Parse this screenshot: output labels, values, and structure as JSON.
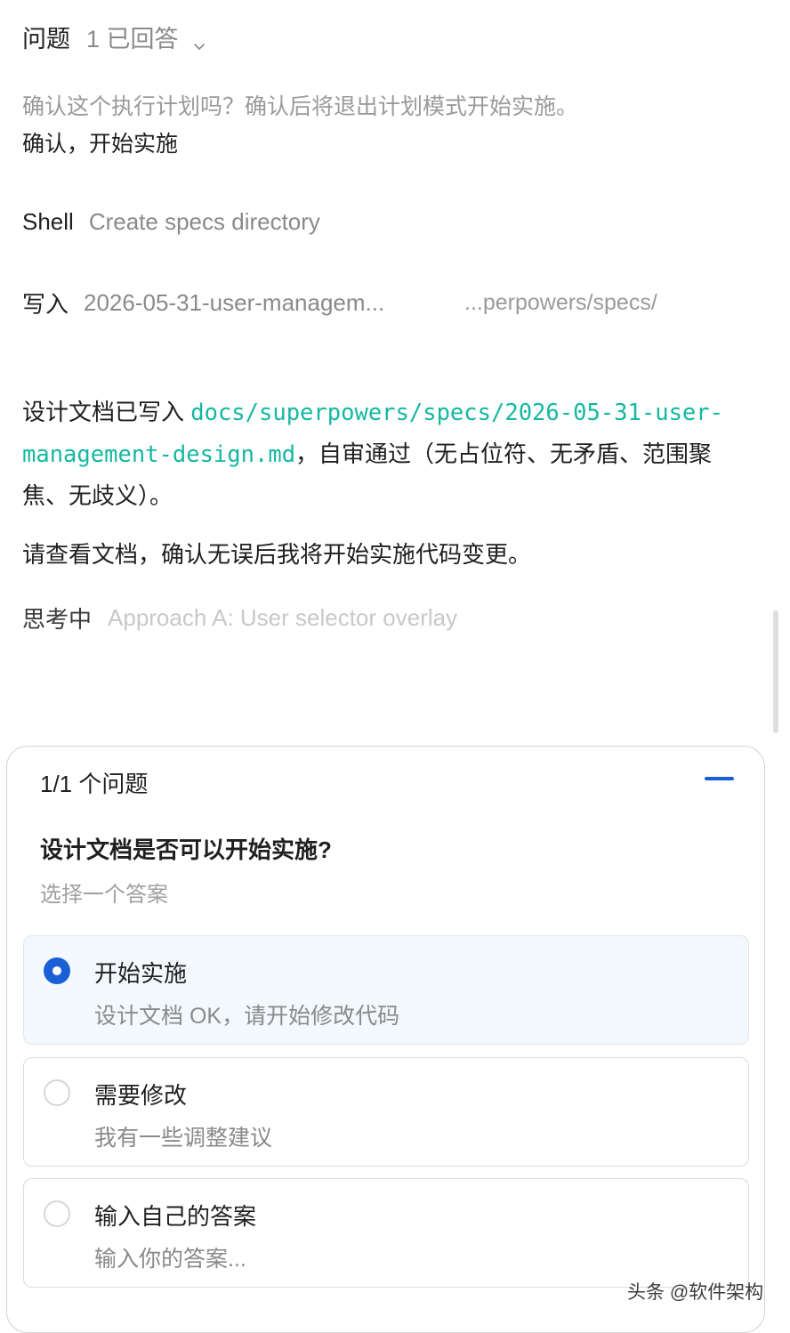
{
  "question_summary": {
    "label": "问题",
    "count": "1 已回答",
    "icon": "chevron-down-icon"
  },
  "prompt": "确认这个执行计划吗？确认后将退出计划模式开始实施。",
  "answer": "确认，开始实施",
  "shell_step": {
    "tool": "Shell",
    "description": "Create specs directory"
  },
  "write_step": {
    "tool": "写入",
    "filename": "2026-05-31-user-managem...",
    "path": "...perpowers/specs/"
  },
  "message": {
    "part1": "设计文档已写入 ",
    "code": "docs/superpowers/specs/2026-05-31-user-management-design.md",
    "part2": "，自审通过（无占位符、无矛盾、范围聚焦、无歧义）。",
    "line2": "请查看文档，确认无误后我将开始实施代码变更。"
  },
  "thinking": {
    "label": "思考中",
    "text": "Approach A: User selector overlay"
  },
  "question_panel": {
    "header": "1/1 个问题",
    "question": "设计文档是否可以开始实施?",
    "hint": "选择一个答案",
    "options": [
      {
        "label": "开始实施",
        "description": "设计文档 OK，请开始修改代码",
        "selected": true
      },
      {
        "label": "需要修改",
        "description": "我有一些调整建议",
        "selected": false
      },
      {
        "label": "输入自己的答案",
        "description": "输入你的答案...",
        "selected": false
      }
    ]
  },
  "watermark": "头条 @软件架构",
  "colors": {
    "accent": "#1a5fd6",
    "code": "#15b8a0",
    "muted": "#8a8a8a"
  }
}
